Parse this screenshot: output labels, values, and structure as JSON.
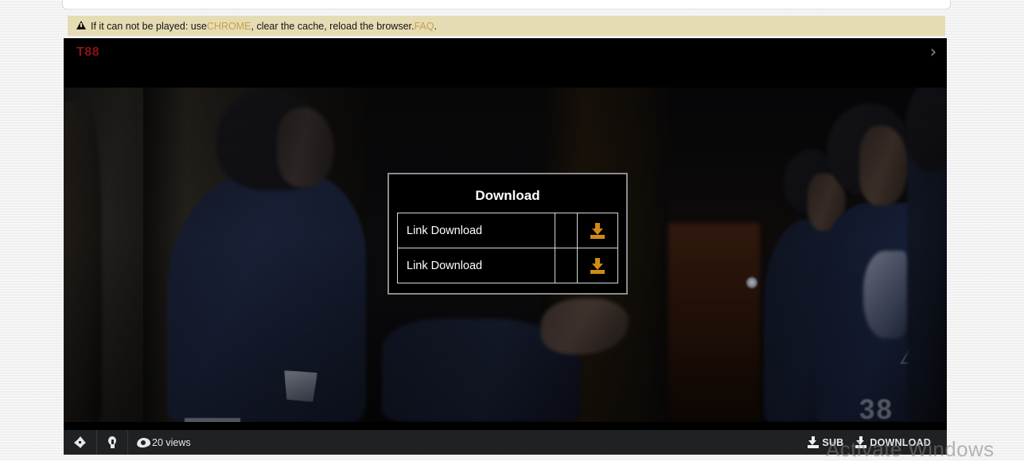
{
  "notice": {
    "icon": "warning-triangle-icon",
    "prefix": "If it can not be played: use ",
    "chrome_link": "CHROME",
    "middle": ", clear the cache, reload the browser. ",
    "faq_link": "FAQ",
    "suffix": ".",
    "bg_color": "#e6dcb4",
    "link_color": "#c9a14a"
  },
  "player": {
    "logo": "T88",
    "logo_color": "#8b1414",
    "next_chevron": "›"
  },
  "dialog": {
    "title": "Download",
    "rows": [
      {
        "label": "Link Download",
        "middle": "",
        "button_icon": "download-icon"
      },
      {
        "label": "Link Download",
        "middle": "",
        "button_icon": "download-icon"
      }
    ],
    "icon_color": "#cf8b15",
    "border_color": "#8c8c8c"
  },
  "controls": {
    "fullscreen_icon": "fullscreen-expand-icon",
    "light_icon": "lightbulb-icon",
    "views_icon": "eye-icon",
    "views_label": "20 views",
    "sub_icon": "download-icon",
    "sub_label": "SUB",
    "download_icon": "download-icon",
    "download_label": "DOWNLOAD",
    "bar_color": "#1f2123"
  },
  "watermark": {
    "text": "Activate Windows"
  }
}
